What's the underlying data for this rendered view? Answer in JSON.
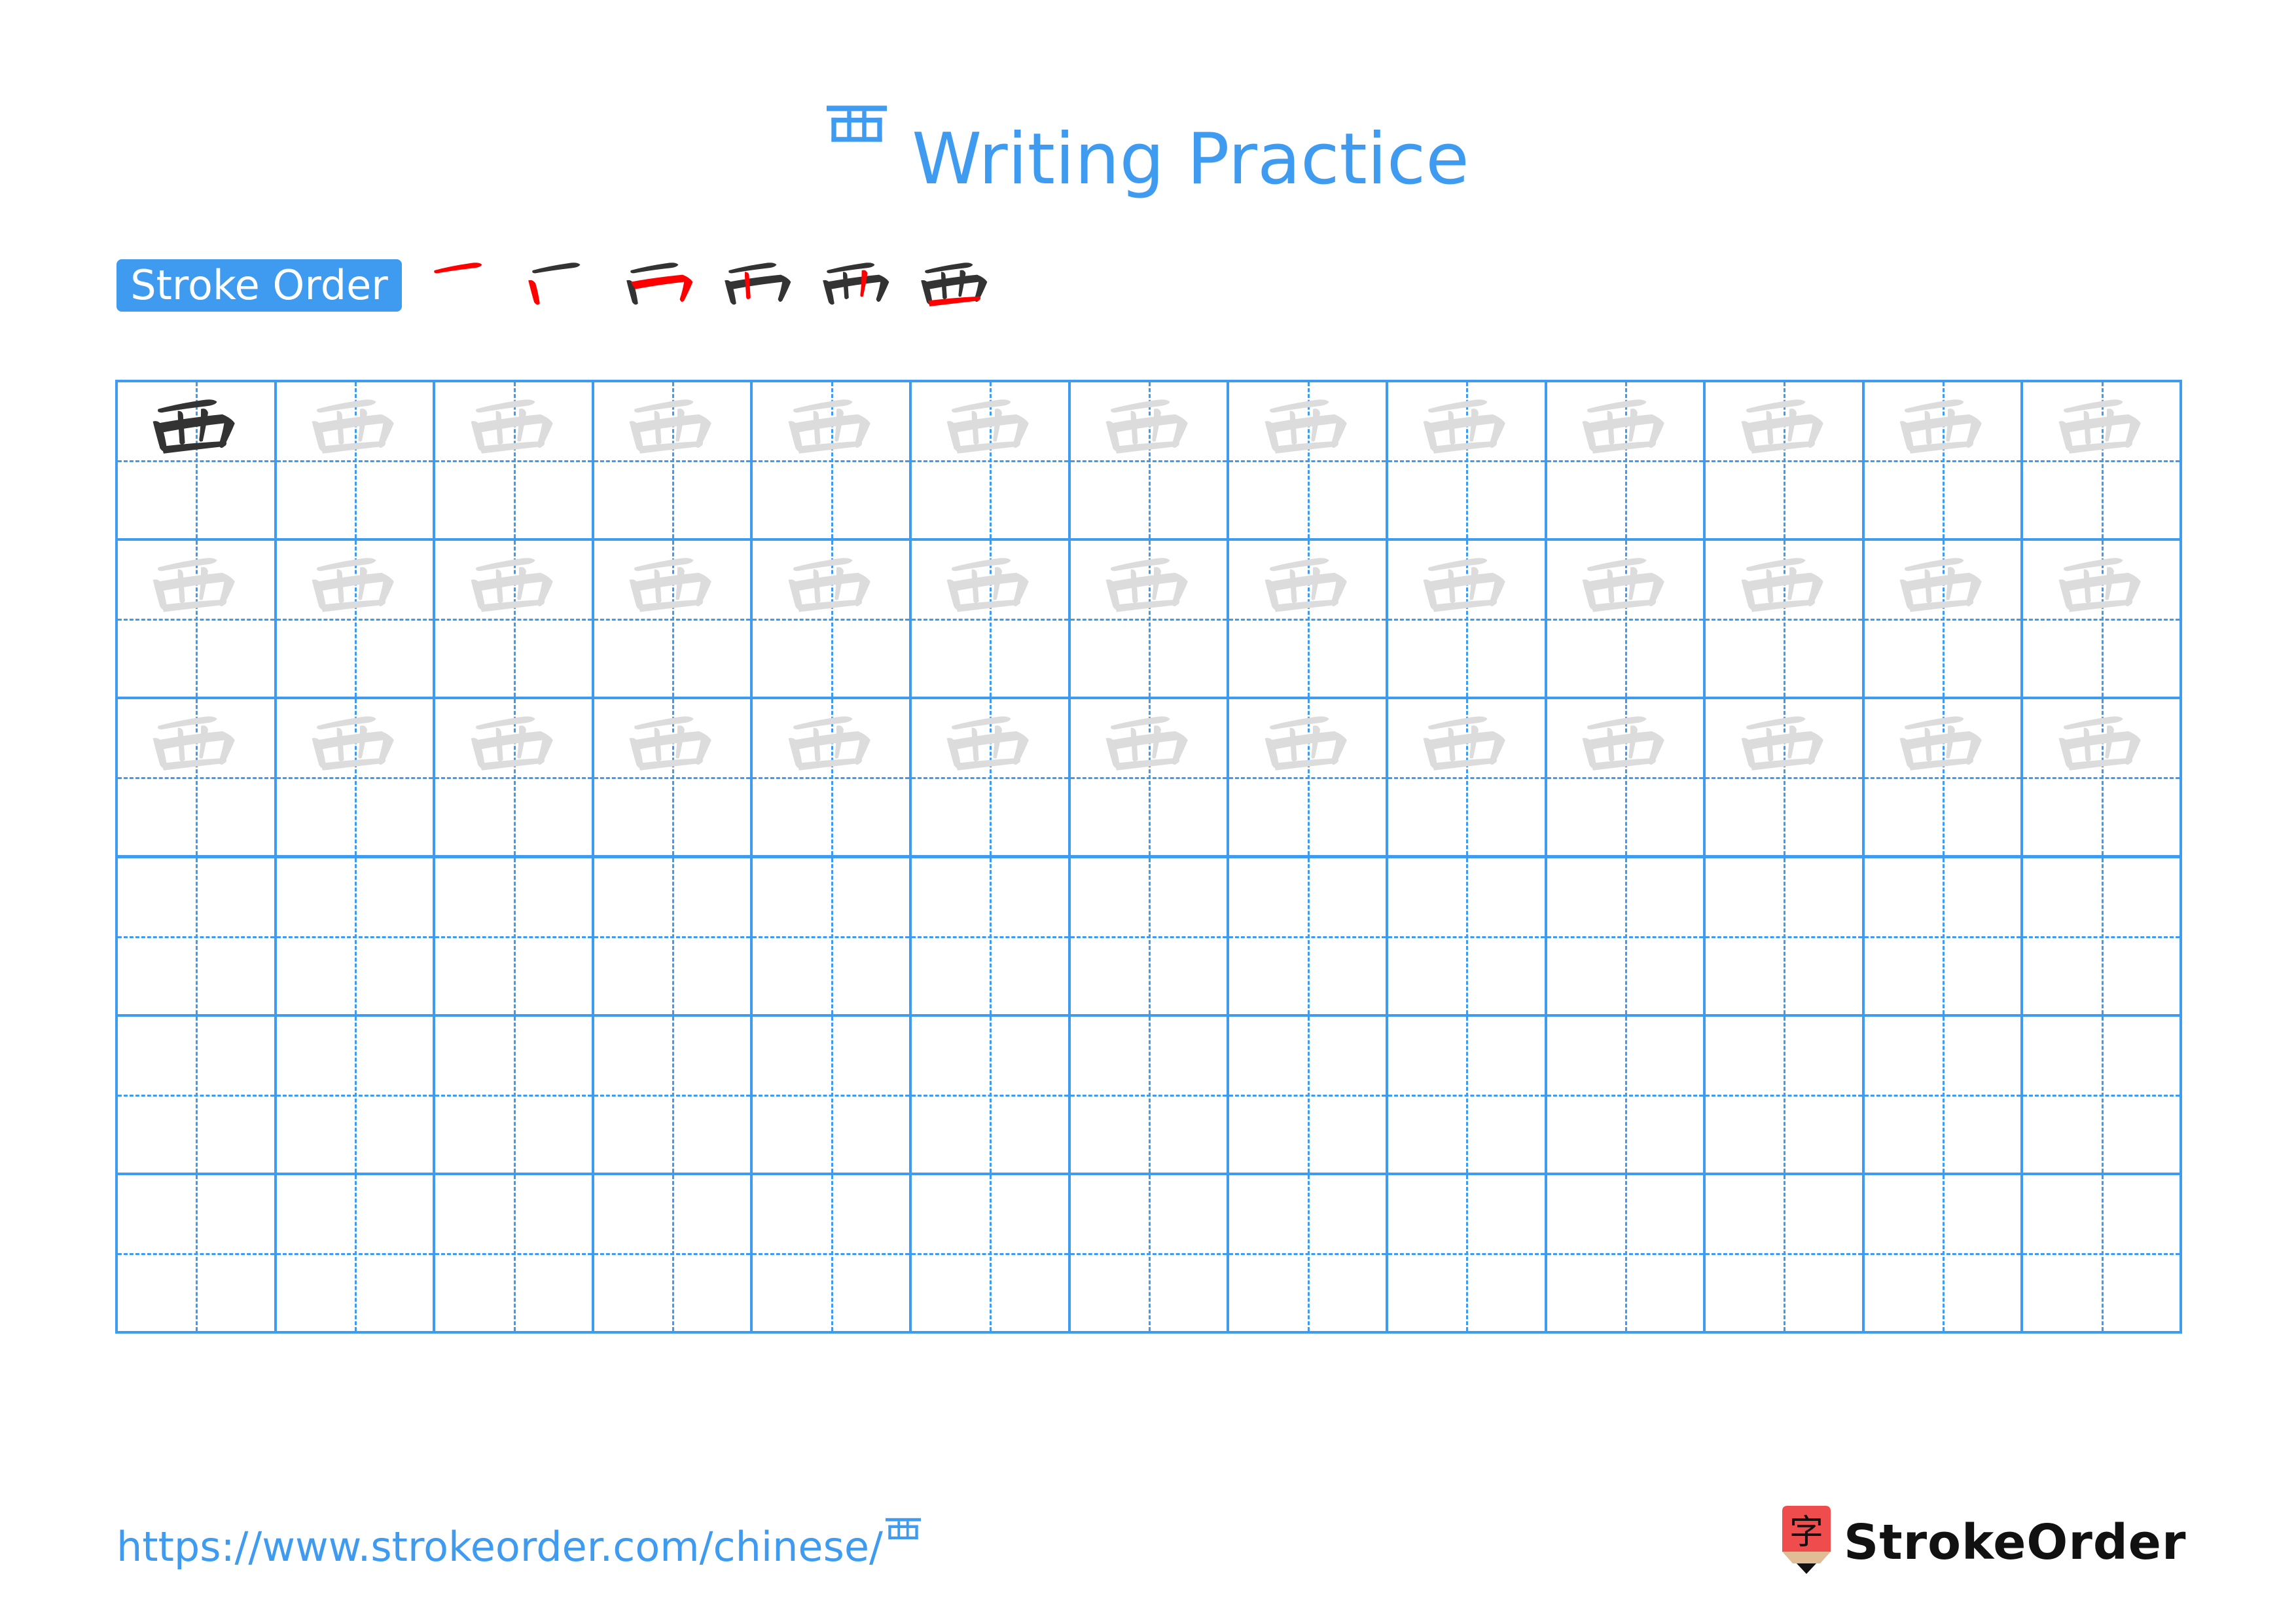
{
  "page": {
    "title_character": "覀",
    "title_text": "Writing Practice",
    "accent_color": "#3f9bf0",
    "trace_color": "#dcdcdc",
    "ink_color": "#333333",
    "highlight_color": "#ff0000"
  },
  "stroke_order": {
    "label": "Stroke Order",
    "stroke_count": 6,
    "steps": [
      {
        "step": 1,
        "highlighted_stroke": "top horizontal"
      },
      {
        "step": 2,
        "highlighted_stroke": "left vertical"
      },
      {
        "step": 3,
        "highlighted_stroke": "horizontal-turn"
      },
      {
        "step": 4,
        "highlighted_stroke": "inner left vertical"
      },
      {
        "step": 5,
        "highlighted_stroke": "inner right vertical"
      },
      {
        "step": 6,
        "highlighted_stroke": "bottom horizontal"
      }
    ]
  },
  "grid": {
    "columns": 13,
    "rows": 6,
    "rows_content": [
      {
        "row": 1,
        "cells": "first cell solid model, remaining 12 gray trace"
      },
      {
        "row": 2,
        "cells": "13 gray trace"
      },
      {
        "row": 3,
        "cells": "13 gray trace"
      },
      {
        "row": 4,
        "cells": "empty"
      },
      {
        "row": 5,
        "cells": "empty"
      },
      {
        "row": 6,
        "cells": "empty"
      }
    ],
    "model_cells": [
      [
        0,
        0
      ]
    ],
    "trace_rows": [
      0,
      1,
      2
    ],
    "character": "覀"
  },
  "footer": {
    "url_text": "https://www.strokeorder.com/chinese/",
    "url_character": "覀",
    "logo_glyph": "字",
    "logo_text": "StrokeOrder"
  }
}
